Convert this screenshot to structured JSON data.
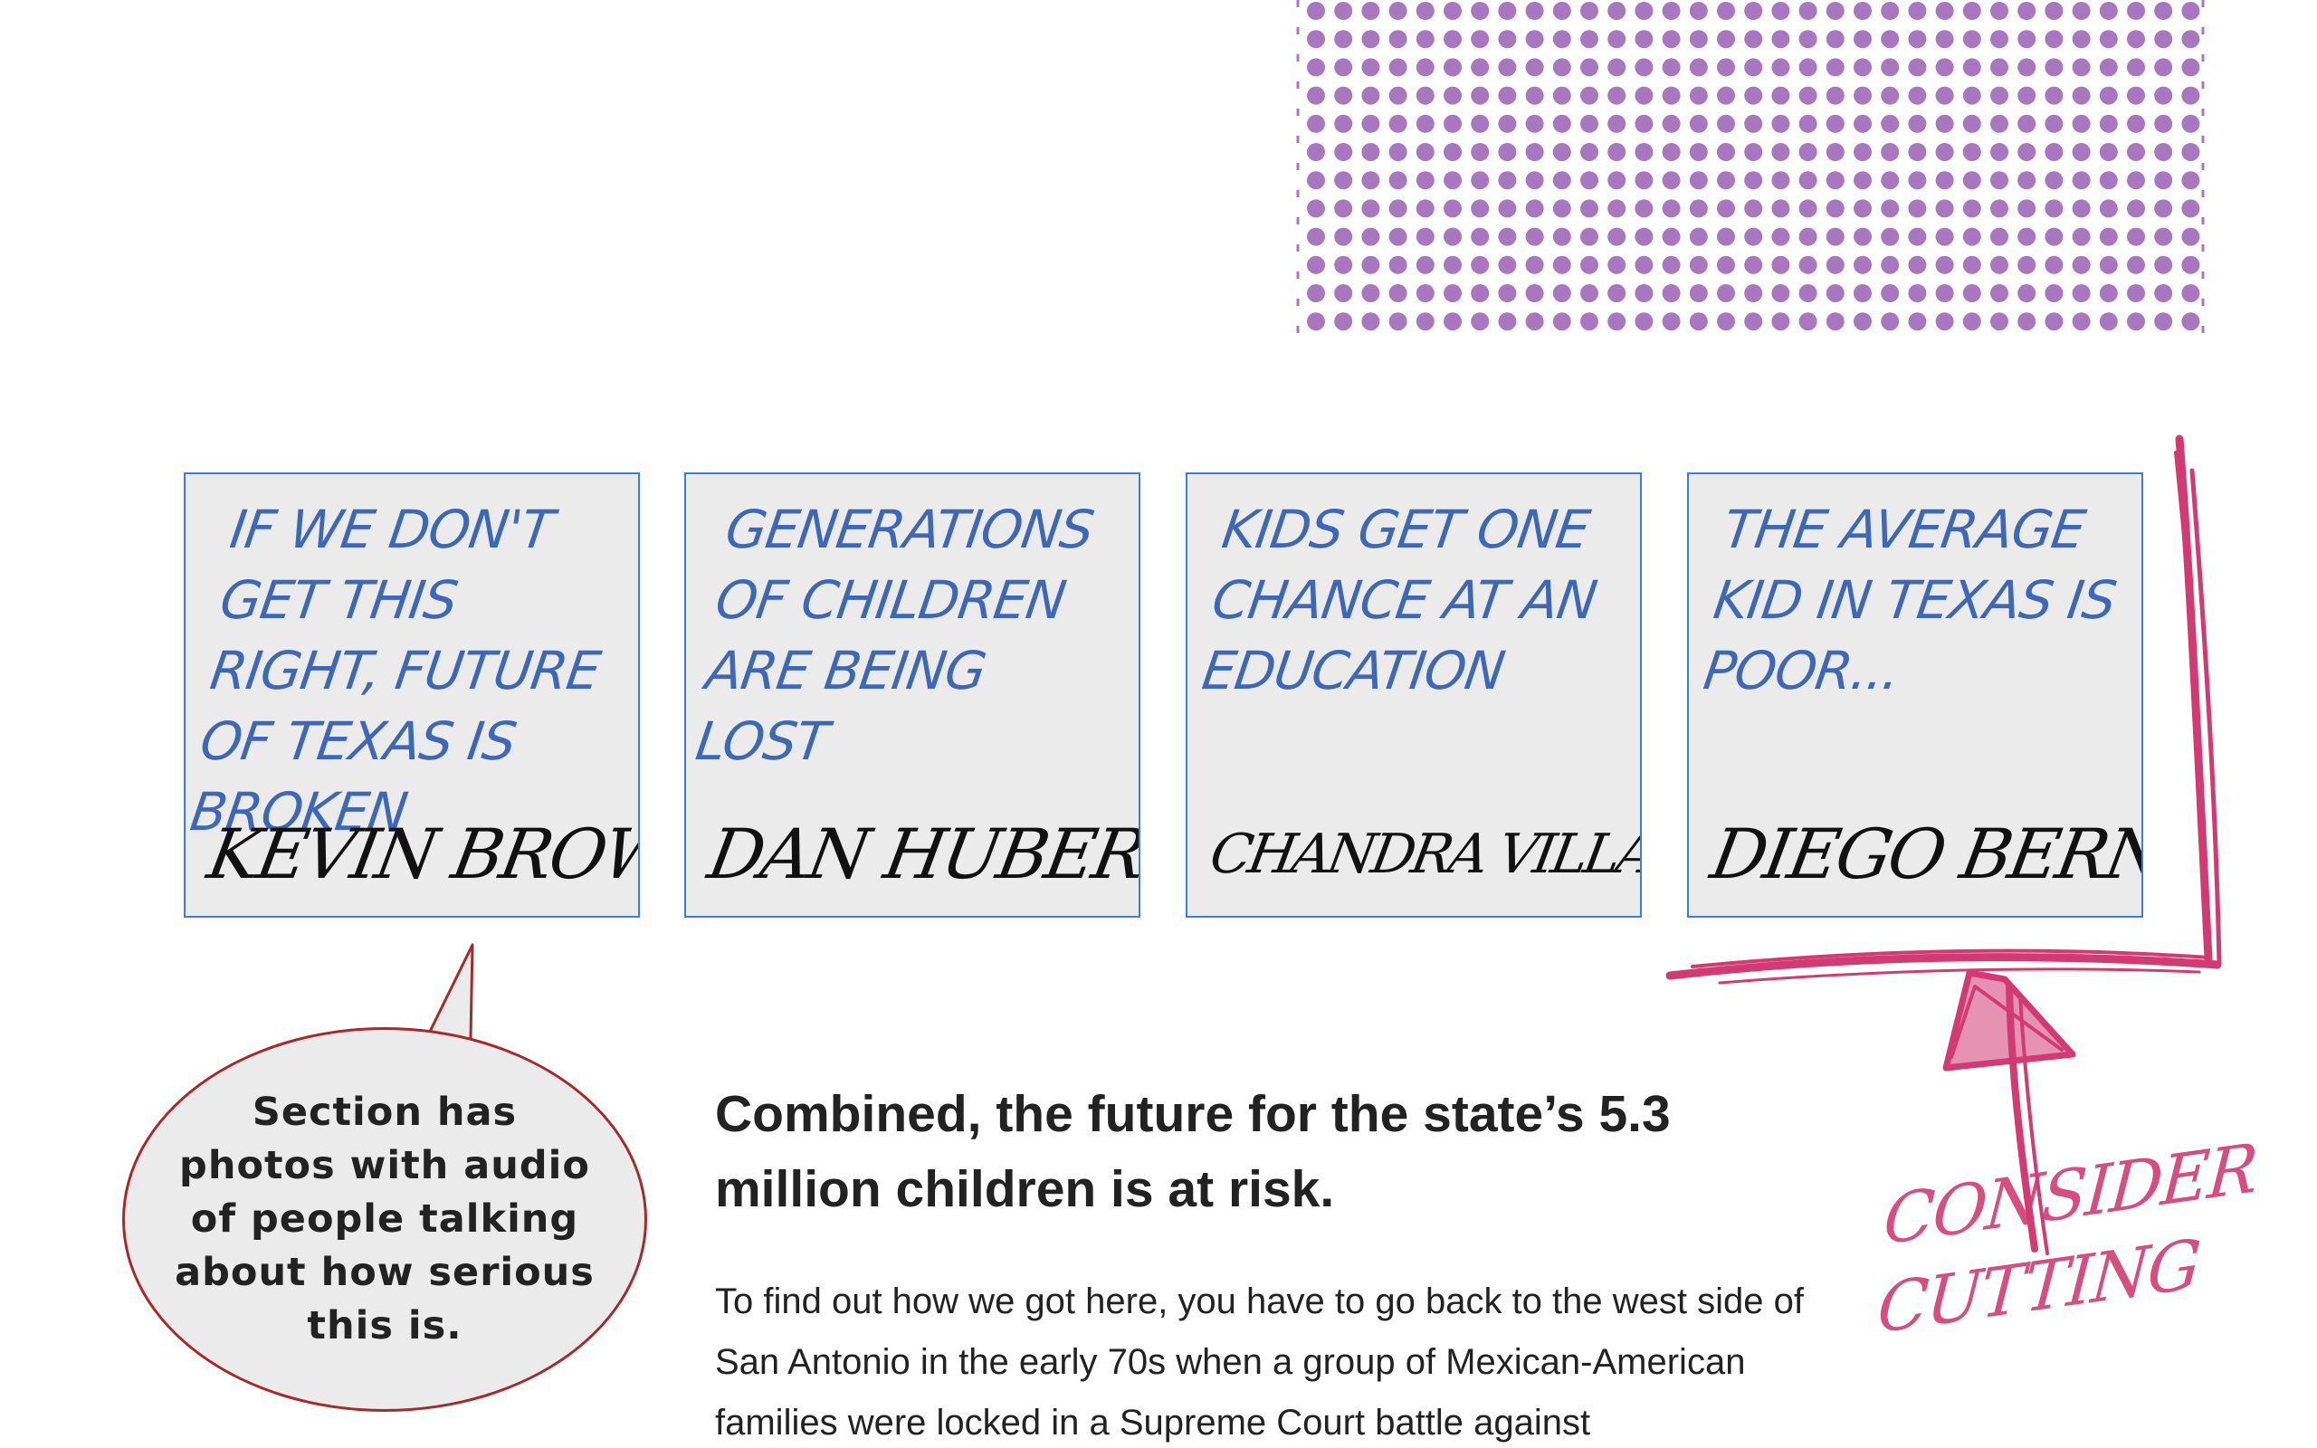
{
  "cards": [
    {
      "quote": "If we don't get this right, future of Texas is broken",
      "signature": "Kevin Brown"
    },
    {
      "quote": "Generations of children are being lost",
      "signature": "Dan Huberty"
    },
    {
      "quote": "Kids get one chance at an education",
      "signature": "Chandra Villanueva"
    },
    {
      "quote": "The average kid in Texas is poor...",
      "signature": "Diego Bernal"
    }
  ],
  "callout": {
    "text": "Section has photos with audio of people talking about how serious this is."
  },
  "article": {
    "headline": "Combined, the future for the state’s 5.3 million children is at risk.",
    "body": "To find out how we got here, you have to go back to the west side of San Antonio in the early 70s when a group of Mexican-American families were locked in a Supreme Court battle against"
  },
  "margin_note": {
    "text": "Consider cutting"
  },
  "colors": {
    "dot": "#a877bf",
    "card_border": "#3b7ee0",
    "quote_ink": "#3f67b7",
    "annotation_ink": "#d23b72",
    "bubble_border": "#a52a2a"
  }
}
